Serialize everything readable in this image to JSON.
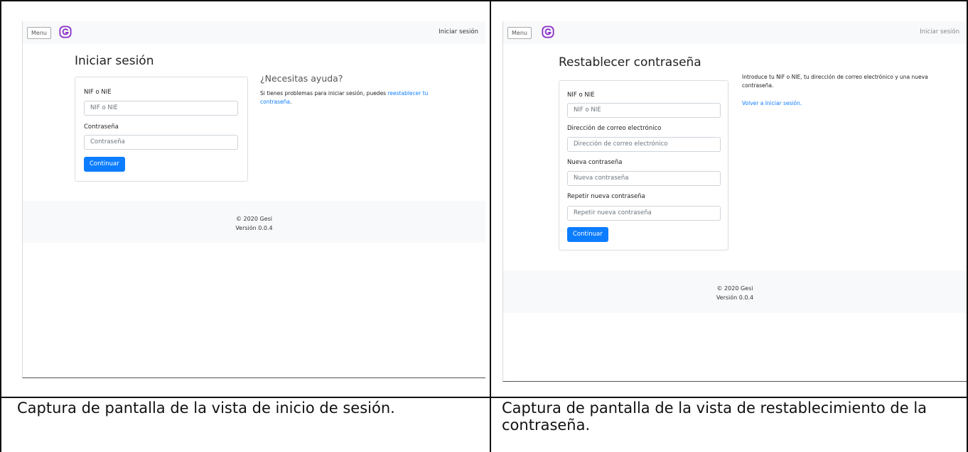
{
  "figure": {
    "left_caption": "Captura de pantalla de la vista de inicio de sesión.",
    "right_caption": "Captura de pantalla de la vista de restablecimiento de la contraseña."
  },
  "login_view": {
    "navbar": {
      "menu_label": "Menu",
      "logo_icon": "gesi-logo-icon",
      "nav_link": "Iniciar sesión"
    },
    "title": "Iniciar sesión",
    "form": {
      "id_label": "NIF o NIE",
      "id_placeholder": "NIF o NIE",
      "password_label": "Contraseña",
      "password_placeholder": "Contraseña",
      "submit_label": "Continuar"
    },
    "help": {
      "title": "¿Necesitas ayuda?",
      "text_before": "Si tienes problemas para iniciar sesión, puedes ",
      "link_text": "reestablecer tu contraseña",
      "text_after": "."
    },
    "footer": {
      "copyright": "© 2020 Gesi",
      "version": "Versión 0.0.4"
    }
  },
  "reset_view": {
    "navbar": {
      "menu_label": "Menu",
      "logo_icon": "gesi-logo-icon",
      "nav_link": "Iniciar sesión"
    },
    "title": "Restablecer contraseña",
    "form": {
      "id_label": "NIF o NIE",
      "id_placeholder": "NIF o NIE",
      "email_label": "Dirección de correo electrónico",
      "email_placeholder": "Dirección de correo electrónico",
      "new_password_label": "Nueva contraseña",
      "new_password_placeholder": "Nueva contraseña",
      "repeat_password_label": "Repetir nueva contraseña",
      "repeat_password_placeholder": "Repetir nueva contraseña",
      "submit_label": "Continuar"
    },
    "help": {
      "text": "Introduce tu NIF o NIE, tu dirección de correo electrónico y una nueva contraseña.",
      "back_link": "Volver a Iniciar sesión."
    },
    "footer": {
      "copyright": "© 2020 Gesi",
      "version": "Versión 0.0.4"
    }
  },
  "colors": {
    "primary": "#0d7dff",
    "logo_purple": "#8b2fc9",
    "navbar_bg": "#f8f9fa"
  }
}
